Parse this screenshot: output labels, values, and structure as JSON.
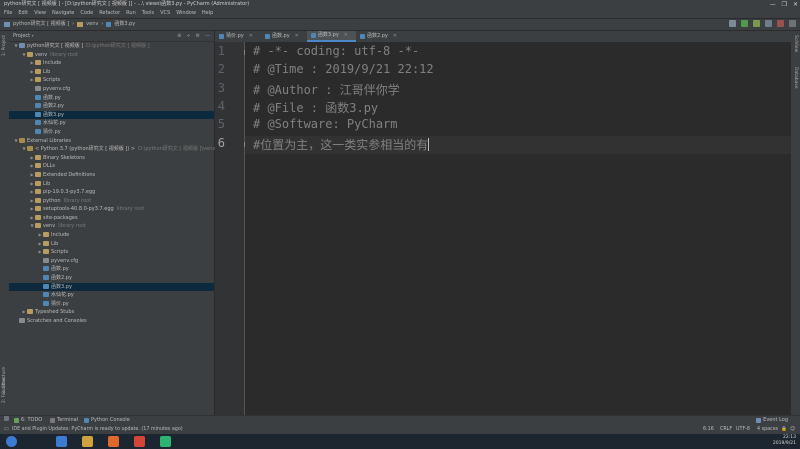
{
  "window": {
    "title": "python研究文 [ 视频版 ] - [D:\\python研究文 [ 视频版 ]] - ...\\ views\\函数3.py - PyCharm (Administrator)",
    "controls": [
      "—",
      "❐",
      "✕"
    ]
  },
  "menu": [
    "File",
    "Edit",
    "View",
    "Navigate",
    "Code",
    "Refactor",
    "Run",
    "Tools",
    "VCS",
    "Window",
    "Help"
  ],
  "breadcrumb": [
    "python研究文 [ 视频版 ]",
    "venv",
    "函数3.py"
  ],
  "project_panel": {
    "header": "Project",
    "tools": [
      "⊕",
      "÷",
      "⚙",
      "—"
    ],
    "rows": [
      {
        "indent": 0,
        "arrow": "▼",
        "icon": "fold-b",
        "label": "python研究文 [ 视频版 ]",
        "hint": "D:\\python研究文 [ 视频版 ]",
        "sel": false
      },
      {
        "indent": 1,
        "arrow": "▼",
        "icon": "fold",
        "label": "venv",
        "hint": "library root",
        "sel": false
      },
      {
        "indent": 2,
        "arrow": "▶",
        "icon": "fold",
        "label": "Include",
        "hint": "",
        "sel": false
      },
      {
        "indent": 2,
        "arrow": "▶",
        "icon": "fold",
        "label": "Lib",
        "hint": "",
        "sel": false
      },
      {
        "indent": 2,
        "arrow": "▶",
        "icon": "fold",
        "label": "Scripts",
        "hint": "",
        "sel": false
      },
      {
        "indent": 2,
        "arrow": "",
        "icon": "cfg",
        "label": "pyvenv.cfg",
        "hint": "",
        "sel": false
      },
      {
        "indent": 2,
        "arrow": "",
        "icon": "pyf",
        "label": "函数.py",
        "hint": "",
        "sel": false
      },
      {
        "indent": 2,
        "arrow": "",
        "icon": "pyf",
        "label": "函数2.py",
        "hint": "",
        "sel": false
      },
      {
        "indent": 2,
        "arrow": "",
        "icon": "pyf",
        "label": "函数3.py",
        "hint": "",
        "sel": true
      },
      {
        "indent": 2,
        "arrow": "",
        "icon": "pyf",
        "label": "水仙花.py",
        "hint": "",
        "sel": false
      },
      {
        "indent": 2,
        "arrow": "",
        "icon": "pyf",
        "label": "猜价.py",
        "hint": "",
        "sel": false
      },
      {
        "indent": 0,
        "arrow": "▼",
        "icon": "libi",
        "label": "External Libraries",
        "hint": "",
        "sel": false
      },
      {
        "indent": 1,
        "arrow": "▼",
        "icon": "libi",
        "label": "< Python 3.7 (python研究文 [ 视频版 ]) >",
        "hint": "D:\\python研究文 [ 视频版 ]\\venv\\Scripts",
        "sel": false
      },
      {
        "indent": 2,
        "arrow": "▶",
        "icon": "fold",
        "label": "Binary Skeletons",
        "hint": "",
        "sel": false
      },
      {
        "indent": 2,
        "arrow": "▶",
        "icon": "fold",
        "label": "DLLs",
        "hint": "",
        "sel": false
      },
      {
        "indent": 2,
        "arrow": "▶",
        "icon": "fold",
        "label": "Extended Definitions",
        "hint": "",
        "sel": false
      },
      {
        "indent": 2,
        "arrow": "▶",
        "icon": "fold",
        "label": "Lib",
        "hint": "",
        "sel": false
      },
      {
        "indent": 2,
        "arrow": "▶",
        "icon": "fold",
        "label": "pip-19.0.3-py3.7.egg",
        "hint": "",
        "sel": false
      },
      {
        "indent": 2,
        "arrow": "▶",
        "icon": "fold",
        "label": "python",
        "hint": "library root",
        "sel": false
      },
      {
        "indent": 2,
        "arrow": "▶",
        "icon": "fold",
        "label": "setuptools-40.8.0-py3.7.egg",
        "hint": "library root",
        "sel": false
      },
      {
        "indent": 2,
        "arrow": "▶",
        "icon": "fold",
        "label": "site-packages",
        "hint": "",
        "sel": false
      },
      {
        "indent": 2,
        "arrow": "▼",
        "icon": "fold",
        "label": "venv",
        "hint": "library root",
        "sel": false
      },
      {
        "indent": 3,
        "arrow": "▶",
        "icon": "fold",
        "label": "Include",
        "hint": "",
        "sel": false
      },
      {
        "indent": 3,
        "arrow": "▶",
        "icon": "fold",
        "label": "Lib",
        "hint": "",
        "sel": false
      },
      {
        "indent": 3,
        "arrow": "▶",
        "icon": "fold",
        "label": "Scripts",
        "hint": "",
        "sel": false
      },
      {
        "indent": 3,
        "arrow": "",
        "icon": "cfg",
        "label": "pyvenv.cfg",
        "hint": "",
        "sel": false
      },
      {
        "indent": 3,
        "arrow": "",
        "icon": "pyf",
        "label": "函数.py",
        "hint": "",
        "sel": false
      },
      {
        "indent": 3,
        "arrow": "",
        "icon": "pyf",
        "label": "函数2.py",
        "hint": "",
        "sel": false
      },
      {
        "indent": 3,
        "arrow": "",
        "icon": "pyf",
        "label": "函数3.py",
        "hint": "",
        "sel": true
      },
      {
        "indent": 3,
        "arrow": "",
        "icon": "pyf",
        "label": "水仙花.py",
        "hint": "",
        "sel": false
      },
      {
        "indent": 3,
        "arrow": "",
        "icon": "pyf",
        "label": "猜价.py",
        "hint": "",
        "sel": false
      },
      {
        "indent": 1,
        "arrow": "▶",
        "icon": "fold",
        "label": "Typeshed Stubs",
        "hint": "",
        "sel": false
      },
      {
        "indent": 0,
        "arrow": "",
        "icon": "cfg",
        "label": "Scratches and Consoles",
        "hint": "",
        "sel": false
      }
    ]
  },
  "left_strip": [
    "1: Project",
    "2: Structure",
    "2: Favorites"
  ],
  "right_strip": [
    "SciView",
    "Database"
  ],
  "tabs": [
    {
      "label": "猜价.py",
      "active": false
    },
    {
      "label": "函数.py",
      "active": false
    },
    {
      "label": "函数3.py",
      "active": true
    },
    {
      "label": "函数2.py",
      "active": false
    }
  ],
  "editor": {
    "lines": [
      "# -*- coding: utf-8 -*-",
      "# @Time : 2019/9/21 22:12",
      "# @Author : 江哥伴你学",
      "# @File : 函数3.py",
      "# @Software: PyCharm",
      "#位置为主，这一类实参相当的有"
    ],
    "current_line": 6
  },
  "bottom_tools": [
    {
      "label": "6: TODO",
      "color": "#6a9f5b"
    },
    {
      "label": "Terminal",
      "color": "#7a7a7a"
    },
    {
      "label": "Python Console",
      "color": "#4e86b5"
    }
  ],
  "event_log": "Event Log",
  "status": {
    "message": "IDE and Plugin Updates: PyCharm is ready to update. (17 minutes ago)",
    "position": "6:16",
    "line_sep": "CRLF",
    "encoding": "UTF-8",
    "indent": "4 spaces"
  },
  "taskbar": {
    "icons": [
      {
        "name": "start-icon",
        "color": "#3d7bd0"
      },
      {
        "name": "ie-icon",
        "color": "#3d7bd0"
      },
      {
        "name": "explorer-icon",
        "color": "#d0a23d"
      },
      {
        "name": "firefox-icon",
        "color": "#e0682c"
      },
      {
        "name": "chrome-icon",
        "color": "#d34536"
      },
      {
        "name": "pycharm-icon",
        "color": "#2db372"
      }
    ],
    "time": "22:13",
    "date": "2019/9/21"
  }
}
